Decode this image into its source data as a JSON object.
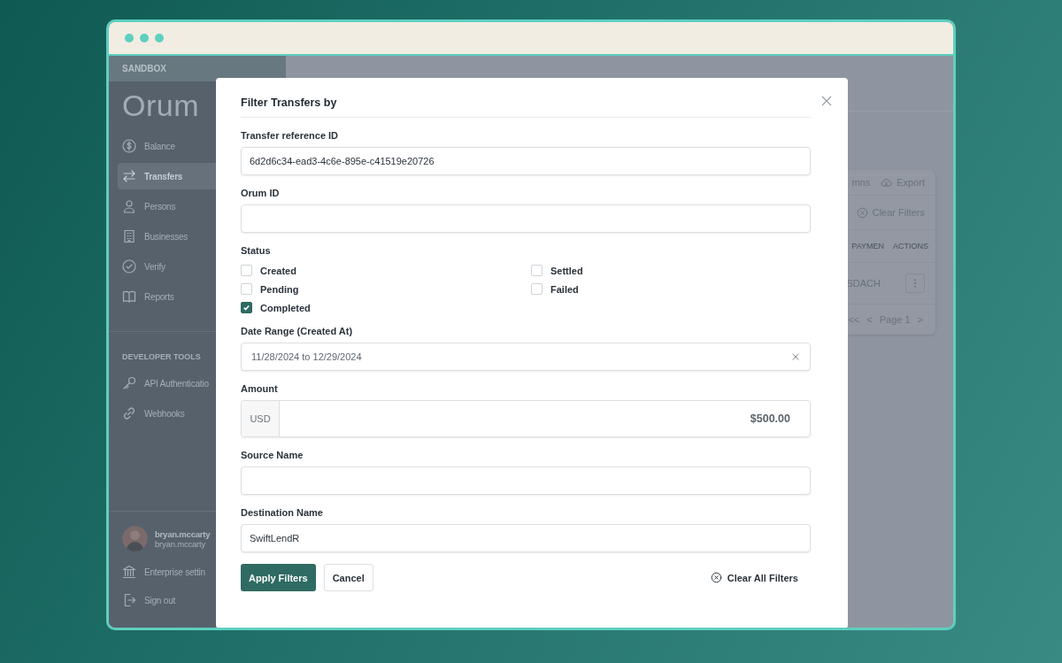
{
  "sidebar": {
    "environment": "SANDBOX",
    "logo": "Orum",
    "items": [
      {
        "label": "Balance",
        "selected": false
      },
      {
        "label": "Transfers",
        "selected": true
      },
      {
        "label": "Persons",
        "selected": false
      },
      {
        "label": "Businesses",
        "selected": false
      },
      {
        "label": "Verify",
        "selected": false
      },
      {
        "label": "Reports",
        "selected": false
      }
    ],
    "developer_tools": {
      "heading": "DEVELOPER TOOLS",
      "items": [
        "API Authenticatio",
        "Webhooks"
      ]
    },
    "user": {
      "name": "bryan.mccarty",
      "email": "bryan.mccarty"
    },
    "footer_items": [
      "Enterprise settin",
      "Sign out"
    ]
  },
  "background_card": {
    "columns_button": "mns",
    "export_button": "Export",
    "clear_filters": "Clear Filters",
    "headers": [
      "PAYMEN",
      "ACTIONS"
    ],
    "rows": [
      {
        "cells": [
          "SDACH"
        ]
      }
    ],
    "pagination": {
      "first": "<<",
      "prev": "<",
      "page": "Page 1",
      "next": ">"
    }
  },
  "modal": {
    "title": "Filter Transfers by",
    "fields": [
      {
        "kind": "text",
        "label": "Transfer reference ID",
        "value": "6d2d6c34-ead3-4c6e-895e-c41519e20726"
      },
      {
        "kind": "text",
        "label": "Orum ID"
      },
      {
        "kind": "checkboxes",
        "label": "Status",
        "options": [
          {
            "label": "Created",
            "checked": false
          },
          {
            "label": "Settled",
            "checked": false
          },
          {
            "label": "Pending",
            "checked": false
          },
          {
            "label": "Failed",
            "checked": false
          },
          {
            "label": "Completed",
            "checked": true
          }
        ]
      },
      {
        "kind": "daterange",
        "label": "Date Range (Created At)",
        "value": "11/28/2024 to 12/29/2024"
      },
      {
        "kind": "amount",
        "label": "Amount",
        "currency": "USD",
        "value": "$500.00"
      },
      {
        "kind": "text",
        "label": "Source Name"
      },
      {
        "kind": "text",
        "label": "Destination Name",
        "value": "SwiftLendR"
      }
    ],
    "apply_button": "Apply Filters",
    "cancel_button": "Cancel",
    "clear_all_button": "Clear All Filters"
  }
}
